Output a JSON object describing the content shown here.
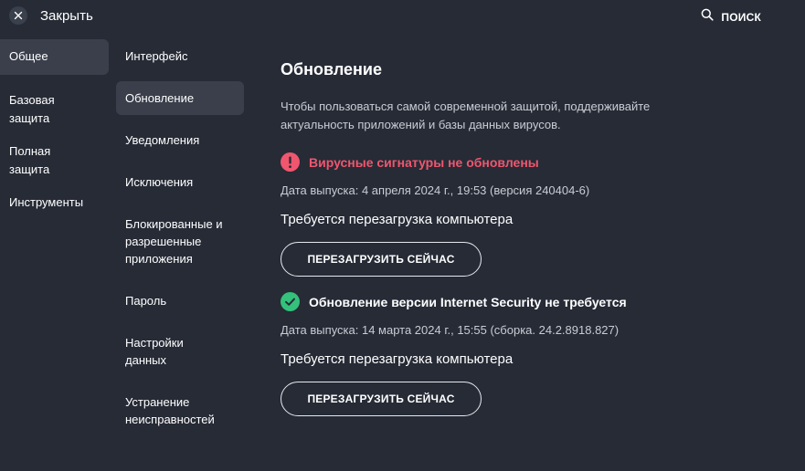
{
  "header": {
    "close_label": "Закрыть",
    "search_label": "ПОИСК"
  },
  "nav_primary": {
    "items": [
      {
        "label": "Общее",
        "active": true
      },
      {
        "label": "Базовая защита",
        "active": false
      },
      {
        "label": "Полная защита",
        "active": false
      },
      {
        "label": "Инструменты",
        "active": false
      }
    ]
  },
  "nav_secondary": {
    "items": [
      {
        "label": "Интерфейс",
        "active": false
      },
      {
        "label": "Обновление",
        "active": true
      },
      {
        "label": "Уведомления",
        "active": false
      },
      {
        "label": "Исключения",
        "active": false
      },
      {
        "label": "Блокированные и разрешенные приложения",
        "active": false
      },
      {
        "label": "Пароль",
        "active": false
      },
      {
        "label": "Настройки данных",
        "active": false
      },
      {
        "label": "Устранение неисправностей",
        "active": false
      }
    ]
  },
  "main": {
    "title": "Обновление",
    "description": "Чтобы пользоваться самой современной защитой, поддерживайте актуальность приложений и базы данных вирусов.",
    "sections": [
      {
        "status": "error",
        "icon": "exclamation-icon",
        "title": "Вирусные сигнатуры не обновлены",
        "release": "Дата выпуска: 4 апреля 2024 г., 19:53 (версия 240404-6)",
        "restart_text": "Требуется перезагрузка компьютера",
        "button_label": "ПЕРЕЗАГРУЗИТЬ СЕЙЧАС"
      },
      {
        "status": "ok",
        "icon": "check-icon",
        "title": "Обновление версии Internet Security не требуется",
        "release": "Дата выпуска: 14 марта 2024 г., 15:55 (сборка. 24.2.8918.827)",
        "restart_text": "Требуется перезагрузка компьютера",
        "button_label": "ПЕРЕЗАГРУЗИТЬ СЕЙЧАС"
      }
    ]
  },
  "colors": {
    "background": "#262b36",
    "active_item": "#3a3f4b",
    "error": "#f0566e",
    "success": "#34c17b",
    "muted_text": "#c9ccd3"
  }
}
